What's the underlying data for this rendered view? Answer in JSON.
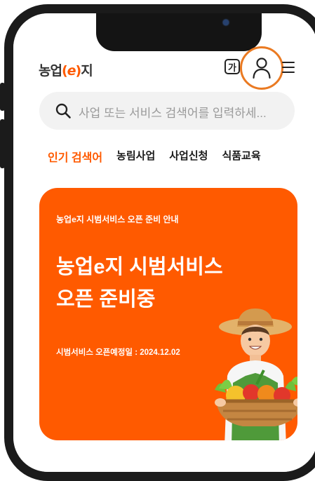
{
  "header": {
    "logo": {
      "pre": "농업",
      "open": "(",
      "mid": "e",
      "close": ")",
      "post": "지"
    },
    "font_size_label": "가"
  },
  "search": {
    "placeholder": "사업 또는 서비스 검색어를 입력하세..."
  },
  "tabs": [
    {
      "label": "인기 검색어",
      "active": true
    },
    {
      "label": "농림사업"
    },
    {
      "label": "사업신청"
    },
    {
      "label": "식품교육"
    }
  ],
  "banner": {
    "subtitle": "농업e지 시범서비스 오픈 준비 안내",
    "title_line1": "농업e지 시범서비스",
    "title_line2": "오픈 준비중",
    "date": "시범서비스 오픈예정일 : 2024.12.02"
  },
  "colors": {
    "accent": "#ff5a00",
    "highlight_circle": "#ea7a22",
    "search_bg": "#f2f2f2"
  },
  "icons": [
    "font-size-icon",
    "user-icon",
    "menu-icon",
    "search-icon",
    "farmer-illustration"
  ]
}
